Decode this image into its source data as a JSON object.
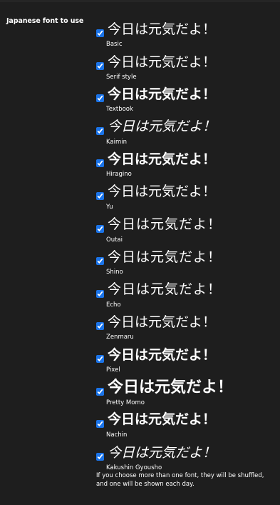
{
  "setting": {
    "label": "Japanese font to use",
    "help_text": "If you choose more than one font, they will be shuffled, and one will be shown each day."
  },
  "sample_text": "今日は元気だよ！",
  "fonts": [
    {
      "name": "Basic",
      "checked": true
    },
    {
      "name": "Serif style",
      "checked": true
    },
    {
      "name": "Textbook",
      "checked": true
    },
    {
      "name": "Kaimin",
      "checked": true
    },
    {
      "name": "Hiragino",
      "checked": true
    },
    {
      "name": "Yu",
      "checked": true
    },
    {
      "name": "Outai",
      "checked": true
    },
    {
      "name": "Shino",
      "checked": true
    },
    {
      "name": "Echo",
      "checked": true
    },
    {
      "name": "Zenmaru",
      "checked": true
    },
    {
      "name": "Pixel",
      "checked": true
    },
    {
      "name": "Pretty Momo",
      "checked": true
    },
    {
      "name": "Nachin",
      "checked": true
    },
    {
      "name": "Kakushin Gyousho",
      "checked": true
    }
  ],
  "colors": {
    "background": "#1e1e1e",
    "text": "#ffffff",
    "checkbox_accent": "#1a73e8"
  }
}
